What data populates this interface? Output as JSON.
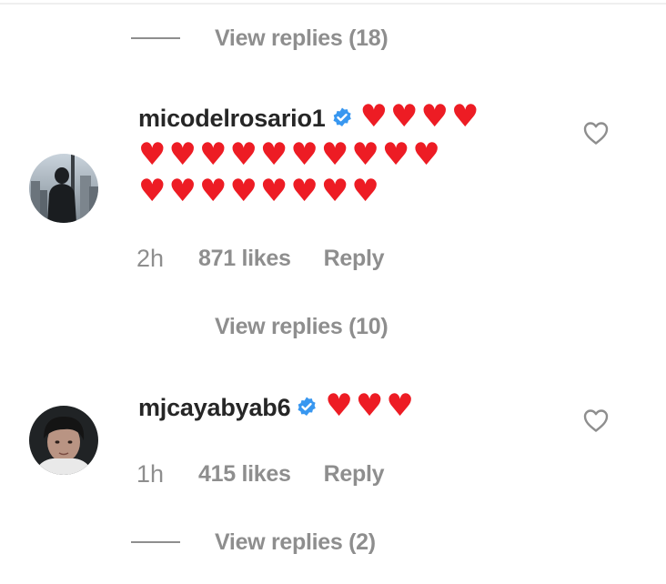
{
  "thread": {
    "top_view_replies": "View replies (18)",
    "comments": [
      {
        "username": "micodelrosario1",
        "verified": true,
        "hearts_line1": "♥♥♥♥",
        "hearts_line2": "♥♥♥♥♥♥♥♥♥♥",
        "hearts_line3": "♥♥♥♥♥♥♥♥",
        "time": "2h",
        "likes": "871 likes",
        "reply_label": "Reply",
        "view_replies": "View replies (10)"
      },
      {
        "username": "mjcayabyab6",
        "verified": true,
        "hearts_line1": "♥♥♥",
        "time": "1h",
        "likes": "415 likes",
        "reply_label": "Reply",
        "view_replies": "View replies (2)"
      }
    ]
  },
  "colors": {
    "muted": "#8e8e8e",
    "heart": "#ed1c24",
    "verified": "#3897f0"
  },
  "icons": {
    "like": "heart-outline-icon",
    "verified": "verified-badge-icon"
  }
}
